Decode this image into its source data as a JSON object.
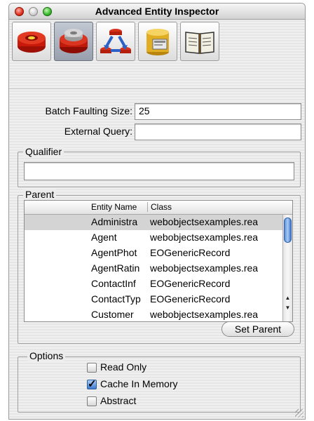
{
  "window": {
    "title": "Advanced Entity Inspector"
  },
  "toolbar": {
    "buttons": [
      {
        "icon": "entity-red-disk-icon",
        "selected": false
      },
      {
        "icon": "entity-gray-disk-icon",
        "selected": true
      },
      {
        "icon": "relationship-arrows-icon",
        "selected": false
      },
      {
        "icon": "database-cylinder-icon",
        "selected": false
      },
      {
        "icon": "open-book-icon",
        "selected": false
      }
    ]
  },
  "form": {
    "batch_faulting_label": "Batch Faulting Size:",
    "batch_faulting_value": "25",
    "external_query_label": "External Query:",
    "external_query_value": ""
  },
  "qualifier": {
    "title": "Qualifier",
    "value": ""
  },
  "parent": {
    "title": "Parent",
    "columns": [
      "Entity Name",
      "Class"
    ],
    "rows": [
      {
        "entity": "Administra",
        "class": "webobjectsexamples.rea"
      },
      {
        "entity": "Agent",
        "class": "webobjectsexamples.rea"
      },
      {
        "entity": "AgentPhot",
        "class": "EOGenericRecord"
      },
      {
        "entity": "AgentRatin",
        "class": "webobjectsexamples.rea"
      },
      {
        "entity": "ContactInf",
        "class": "EOGenericRecord"
      },
      {
        "entity": "ContactTyp",
        "class": "EOGenericRecord"
      },
      {
        "entity": "Customer",
        "class": "webobjectsexamples.rea"
      }
    ],
    "selected_row": 0,
    "set_parent_label": "Set Parent"
  },
  "options": {
    "title": "Options",
    "read_only_label": "Read Only",
    "read_only": false,
    "cache_label": "Cache In Memory",
    "cache_in_memory": true,
    "abstract_label": "Abstract",
    "abstract": false
  }
}
